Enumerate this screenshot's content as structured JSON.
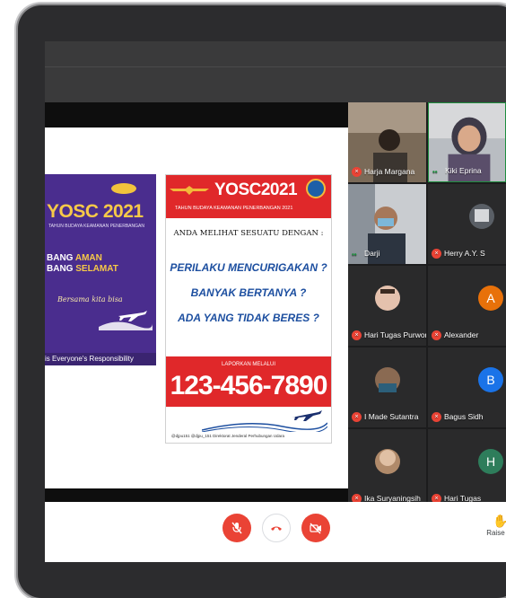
{
  "poster_left": {
    "title": "YOSC 2021",
    "subtitle": "TAHUN BUDAYA KEAMANAN PENERBANGAN",
    "line1_a": "BANG",
    "line1_b": "AMAN",
    "line2_a": "BANG",
    "line2_b": "SELAMAT",
    "script": "Bersama kita bisa",
    "footer": "is Everyone's Responsibility"
  },
  "poster_right": {
    "title": "YOSC2021",
    "subtitle": "TAHUN BUDAYA KEAMANAN PENERBANGAN 2021",
    "question": "ANDA MELIHAT SESUATU DENGAN :",
    "items": [
      "PERILAKU MENCURIGAKAN ?",
      "BANYAK BERTANYA ?",
      "ADA YANG TIDAK BERES ?"
    ],
    "report_label": "LAPORKAN MELALUI",
    "phone": "123-456-7890",
    "footer": "@djpu151   @djpu_151   Direktorat Jenderal Perhubungan Udara"
  },
  "participants": [
    {
      "name": "Harja Margana",
      "status": "muted"
    },
    {
      "name": "Kiki Eprina",
      "status": "speaking"
    },
    {
      "name": "Darji",
      "status": "speaking"
    },
    {
      "name": "Herry A.Y. S",
      "status": "muted"
    },
    {
      "name": "Hari Tugas Purwono",
      "status": "muted"
    },
    {
      "name": "Alexander",
      "status": "muted",
      "initial": "A"
    },
    {
      "name": "I Made Sutantra",
      "status": "muted"
    },
    {
      "name": "Bagus Sidh",
      "status": "muted",
      "initial": "B"
    },
    {
      "name": "Ika Suryaningsih",
      "status": "muted"
    },
    {
      "name": "Hari Tugas",
      "status": "muted",
      "initial": "H"
    }
  ],
  "controls": {
    "raise_hand": "Raise ha"
  },
  "colors": {
    "control_red": "#ea4335",
    "poster_red": "#e0282a",
    "poster_purple": "#4a2d8e",
    "avatar_orange": "#e8710a",
    "avatar_blue": "#1a73e8",
    "avatar_green": "#2e7d5b"
  }
}
